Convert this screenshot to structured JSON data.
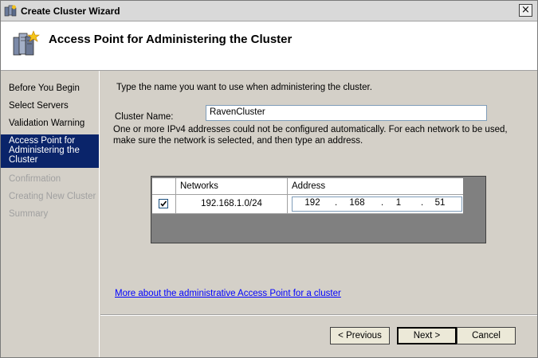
{
  "window": {
    "title": "Create Cluster Wizard",
    "close_glyph": "×"
  },
  "header": {
    "title": "Access Point for Administering the Cluster",
    "icon": "cluster-servers-icon"
  },
  "sidebar": {
    "steps": [
      {
        "label": "Before You Begin",
        "state": "done"
      },
      {
        "label": "Select Servers",
        "state": "done"
      },
      {
        "label": "Validation Warning",
        "state": "done"
      },
      {
        "label": "Access Point for Administering the Cluster",
        "state": "active"
      },
      {
        "label": "Confirmation",
        "state": "disabled"
      },
      {
        "label": "Creating New Cluster",
        "state": "disabled"
      },
      {
        "label": "Summary",
        "state": "disabled"
      }
    ]
  },
  "main": {
    "instruction": "Type the name you want to use when administering the cluster.",
    "cluster_name_label": "Cluster Name:",
    "cluster_name_value": "RavenCluster",
    "ipv4_note": "One or more IPv4 addresses could not be configured automatically.  For each network to be used, make sure the network is selected, and then type an address.",
    "grid": {
      "columns": [
        "Networks",
        "Address"
      ],
      "rows": [
        {
          "checked": true,
          "network": "192.168.1.0/24",
          "address": [
            "192",
            "168",
            "1",
            "51"
          ]
        }
      ]
    },
    "link": "More about the administrative Access Point for a cluster"
  },
  "footer": {
    "previous_label": "< Previous",
    "next_label": "Next >",
    "cancel_label": "Cancel"
  },
  "colors": {
    "active_step_bg": "#0a246a",
    "link": "#0000ff",
    "disabled_text": "#a0a0a0"
  }
}
